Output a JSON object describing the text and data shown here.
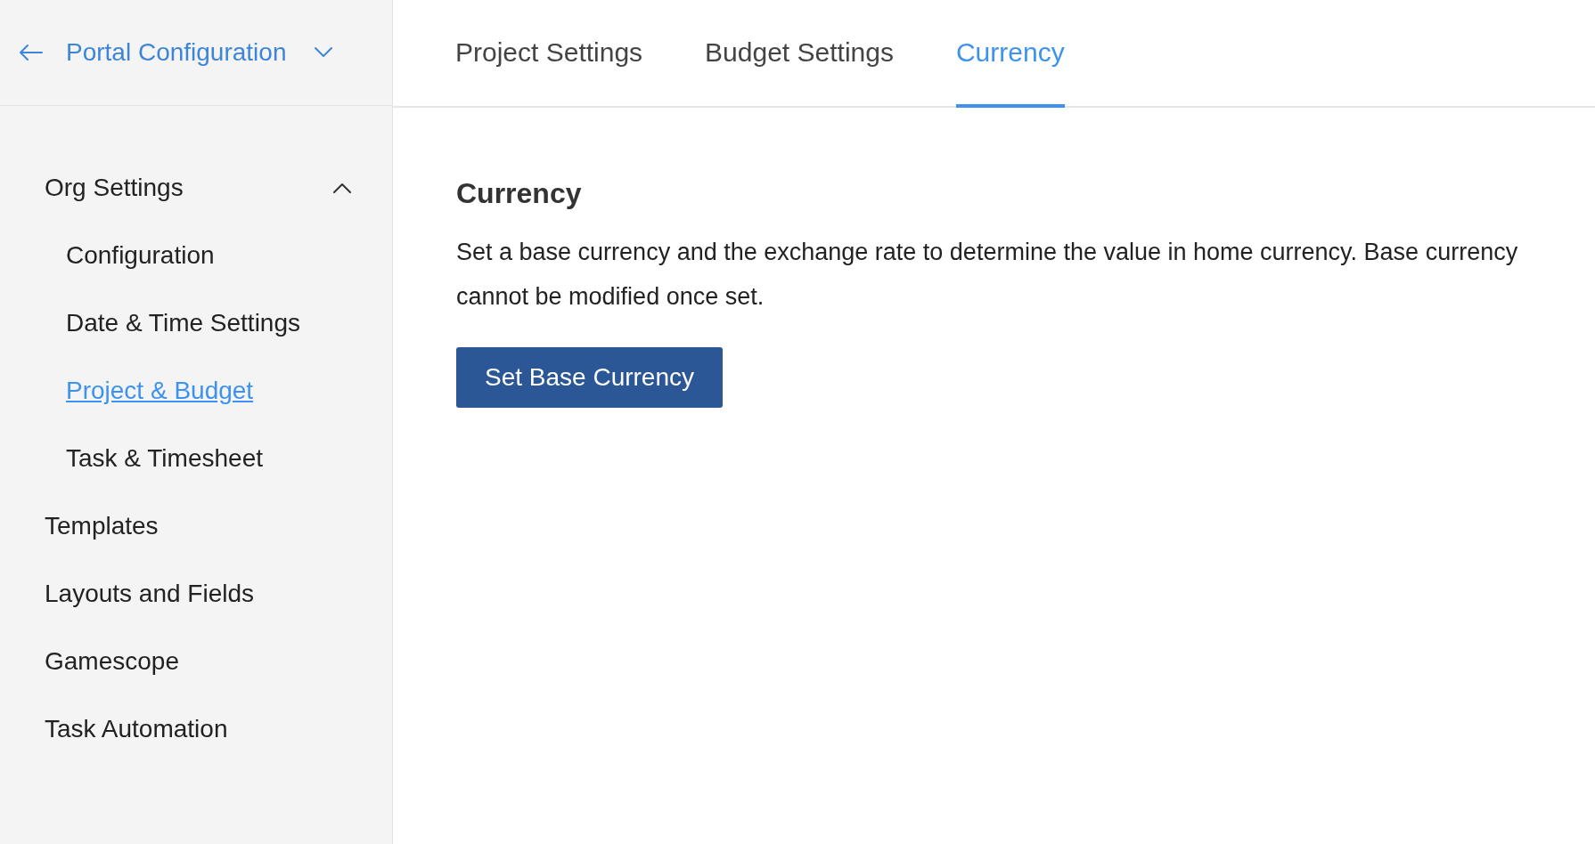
{
  "portal": {
    "title": "Portal Configuration"
  },
  "tabs": [
    {
      "label": "Project Settings",
      "selected": false
    },
    {
      "label": "Budget Settings",
      "selected": false
    },
    {
      "label": "Currency",
      "selected": true
    }
  ],
  "sidebar": {
    "items": [
      {
        "label": "Org Settings",
        "expanded": true,
        "selected": false,
        "children": [
          {
            "label": "Configuration",
            "selected": false
          },
          {
            "label": "Date & Time Settings",
            "selected": false
          },
          {
            "label": "Project & Budget",
            "selected": true
          },
          {
            "label": "Task & Timesheet",
            "selected": false
          }
        ]
      },
      {
        "label": "Templates",
        "selected": false
      },
      {
        "label": "Layouts and Fields",
        "selected": false
      },
      {
        "label": "Gamescope",
        "selected": false
      },
      {
        "label": "Task Automation",
        "selected": false
      }
    ]
  },
  "content": {
    "heading": "Currency",
    "description": "Set a base currency and the exchange rate to determine the value in home currency. Base currency cannot be modified once set.",
    "button": "Set Base Currency"
  }
}
